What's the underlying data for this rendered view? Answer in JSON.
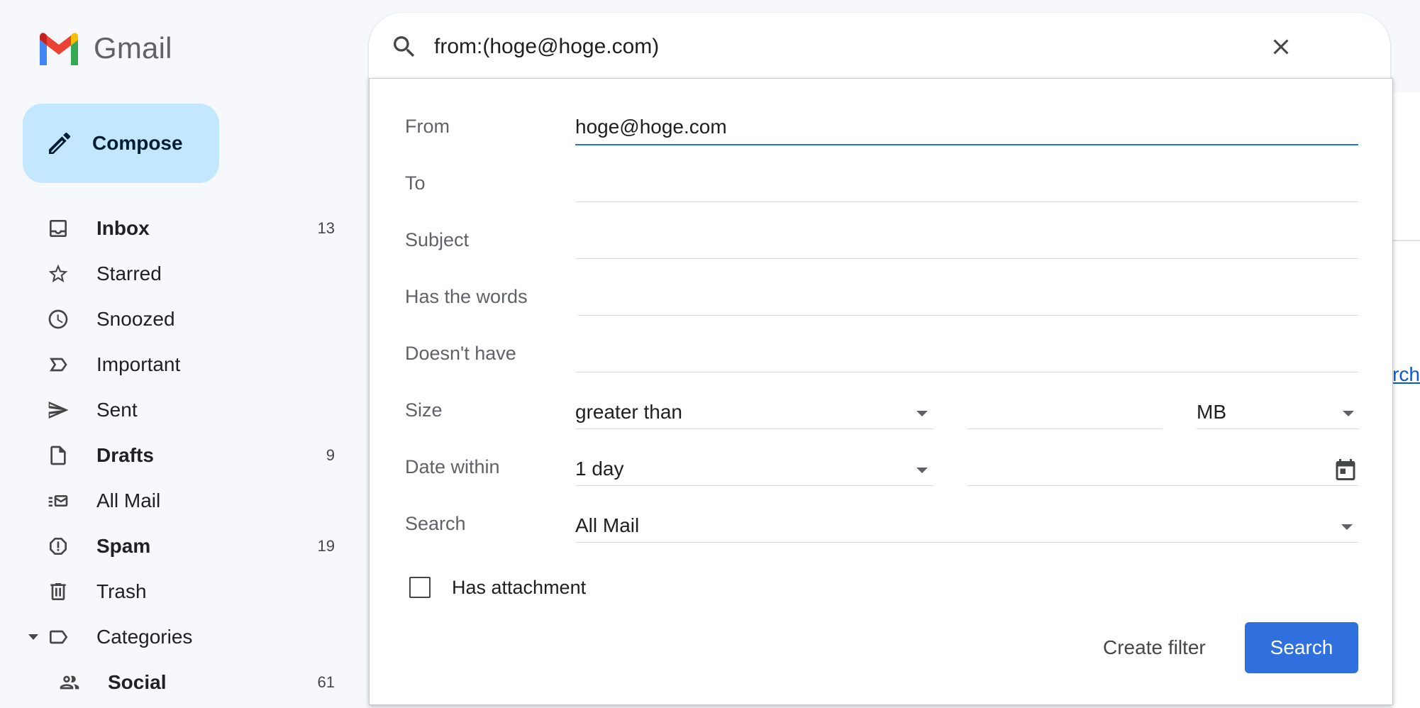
{
  "app": {
    "name": "Gmail"
  },
  "compose": {
    "label": "Compose"
  },
  "sidebar": {
    "items": [
      {
        "label": "Inbox",
        "count": "13",
        "icon": "inbox-icon",
        "bold": true
      },
      {
        "label": "Starred",
        "count": "",
        "icon": "star-icon",
        "bold": false
      },
      {
        "label": "Snoozed",
        "count": "",
        "icon": "clock-icon",
        "bold": false
      },
      {
        "label": "Important",
        "count": "",
        "icon": "important-icon",
        "bold": false
      },
      {
        "label": "Sent",
        "count": "",
        "icon": "send-icon",
        "bold": false
      },
      {
        "label": "Drafts",
        "count": "9",
        "icon": "draft-icon",
        "bold": true
      },
      {
        "label": "All Mail",
        "count": "",
        "icon": "all-mail-icon",
        "bold": false
      },
      {
        "label": "Spam",
        "count": "19",
        "icon": "spam-icon",
        "bold": true
      },
      {
        "label": "Trash",
        "count": "",
        "icon": "trash-icon",
        "bold": false
      },
      {
        "label": "Categories",
        "count": "",
        "icon": "label-icon",
        "bold": false
      },
      {
        "label": "Social",
        "count": "61",
        "icon": "people-icon",
        "bold": true
      }
    ]
  },
  "search": {
    "query": "from:(hoge@hoge.com)"
  },
  "advanced": {
    "from_label": "From",
    "from_value": "hoge@hoge.com",
    "to_label": "To",
    "to_value": "",
    "subject_label": "Subject",
    "subject_value": "",
    "has_words_label": "Has the words",
    "has_words_value": "",
    "doesnt_have_label": "Doesn't have",
    "doesnt_have_value": "",
    "size_label": "Size",
    "size_operator": "greater than",
    "size_value": "",
    "size_unit": "MB",
    "date_label": "Date within",
    "date_value": "1 day",
    "date_field": "",
    "search_in_label": "Search",
    "search_in_value": "All Mail",
    "has_attachment_label": "Has attachment",
    "has_attachment_checked": false,
    "create_filter_label": "Create filter",
    "search_button_label": "Search"
  },
  "background": {
    "link_fragment": "arch"
  },
  "colors": {
    "compose_bg": "#c2e7ff",
    "accent": "#1a73e8",
    "search_button": "#2f6fde",
    "page_bg": "#f6f8fc"
  }
}
